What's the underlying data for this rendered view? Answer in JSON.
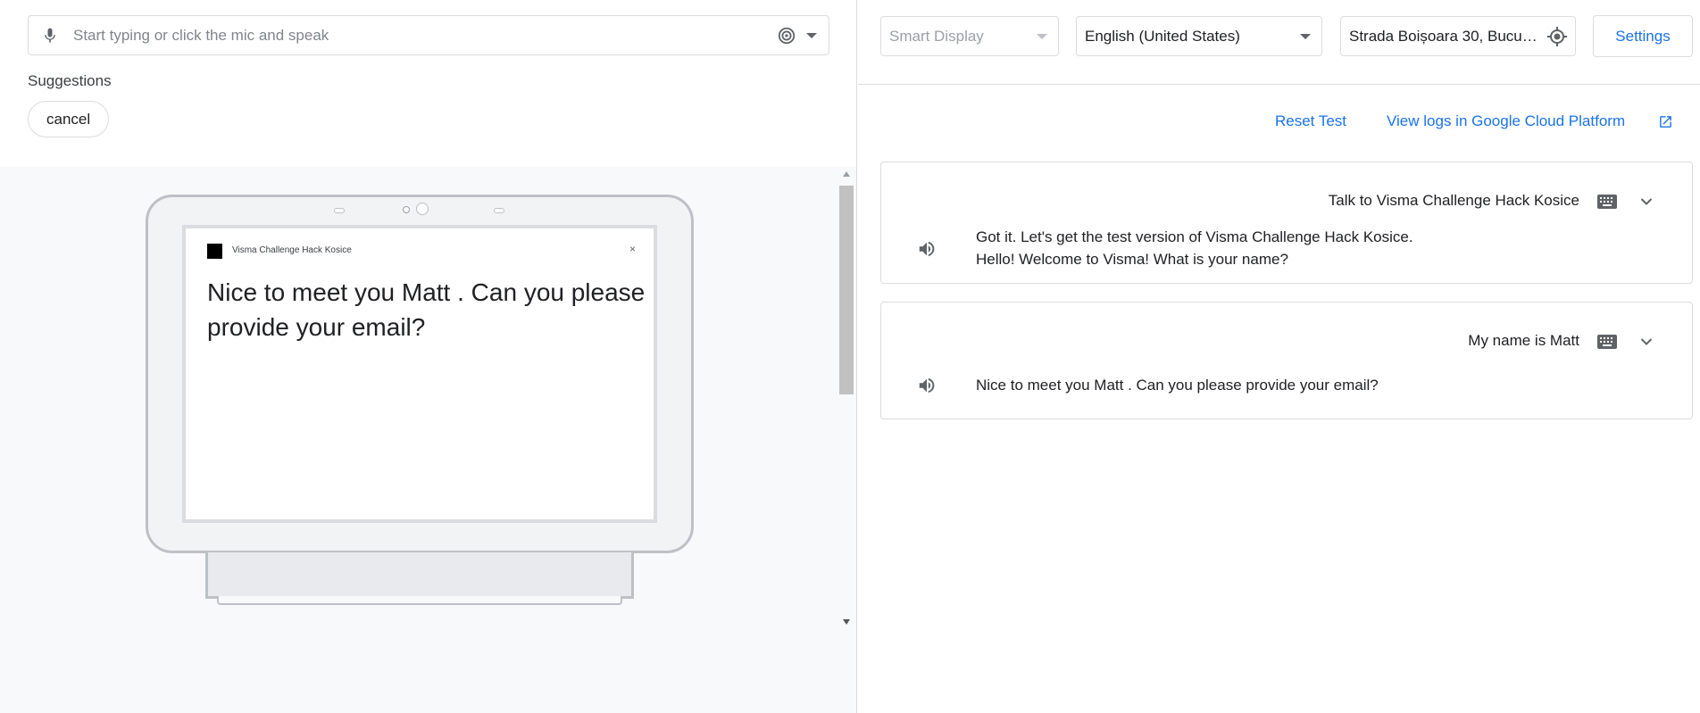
{
  "input": {
    "placeholder": "Start typing or click the mic and speak"
  },
  "suggestions": {
    "label": "Suggestions",
    "chips": [
      "cancel"
    ]
  },
  "device_screen": {
    "app_name": "Visma Challenge Hack Kosice",
    "close_glyph": "×",
    "message": "Nice to meet you Matt . Can you please provide your email?"
  },
  "topbar": {
    "surface": "Smart Display",
    "language": "English (United States)",
    "location": "Strada Boișoara 30, Bucur…",
    "settings_label": "Settings"
  },
  "links": {
    "reset": "Reset Test",
    "logs": "View logs in Google Cloud Platform"
  },
  "conversation": [
    {
      "query": "Talk to Visma Challenge Hack Kosice",
      "response_lines": [
        "Got it. Let's get the test version of Visma Challenge Hack Kosice.",
        "Hello! Welcome to Visma! What is your name?"
      ]
    },
    {
      "query": "My name is Matt",
      "response_lines": [
        "Nice to meet you Matt . Can you please provide your email?"
      ]
    }
  ],
  "colors": {
    "accent": "#1a73e8",
    "border": "#dadce0",
    "stage_bg": "#f8f9fa"
  },
  "icons": {
    "mic": "mic-icon",
    "listen": "listening-icon",
    "dropdown": "chevron-down-icon",
    "target": "my-location-icon",
    "external": "open-in-new-icon",
    "keyboard": "keyboard-icon",
    "speaker": "volume-icon"
  }
}
